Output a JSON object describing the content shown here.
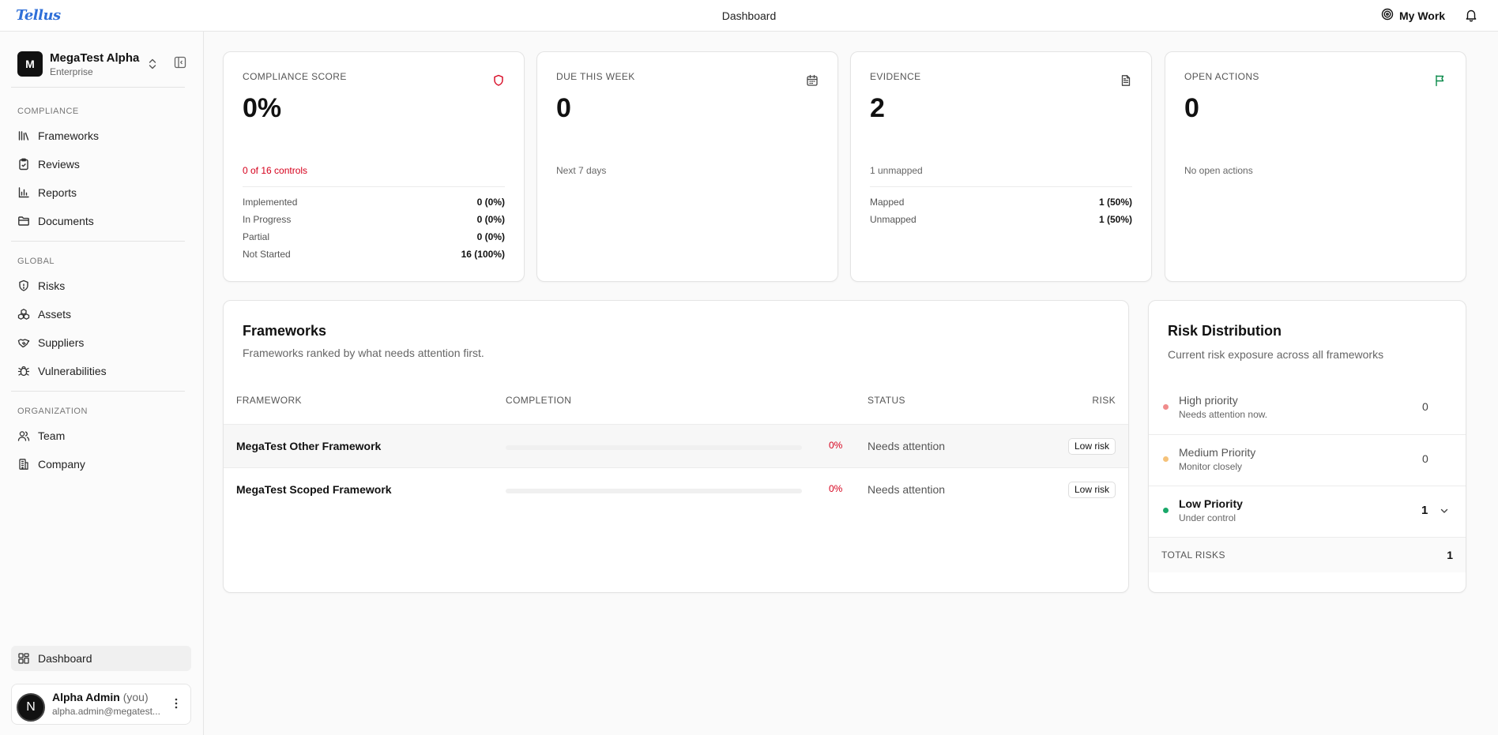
{
  "topbar": {
    "logo": "Tellus",
    "title": "Dashboard",
    "my_work": "My Work"
  },
  "sidebar": {
    "org": {
      "initial": "M",
      "name": "MegaTest Alpha",
      "plan": "Enterprise"
    },
    "sections": [
      {
        "label": "COMPLIANCE",
        "items": [
          {
            "label": "Frameworks",
            "icon": "library-icon"
          },
          {
            "label": "Reviews",
            "icon": "clipboard-check-icon"
          },
          {
            "label": "Reports",
            "icon": "bar-chart-icon"
          },
          {
            "label": "Documents",
            "icon": "folder-icon"
          }
        ]
      },
      {
        "label": "GLOBAL",
        "items": [
          {
            "label": "Risks",
            "icon": "shield-icon"
          },
          {
            "label": "Assets",
            "icon": "boxes-icon"
          },
          {
            "label": "Suppliers",
            "icon": "handshake-icon"
          },
          {
            "label": "Vulnerabilities",
            "icon": "bug-icon"
          }
        ]
      },
      {
        "label": "ORGANIZATION",
        "items": [
          {
            "label": "Team",
            "icon": "users-icon"
          },
          {
            "label": "Company",
            "icon": "building-icon"
          }
        ]
      }
    ],
    "dashboard_label": "Dashboard",
    "user": {
      "initial": "N",
      "name": "Alpha Admin",
      "you": "(you)",
      "email": "alpha.admin@megatest..."
    }
  },
  "stats": {
    "compliance": {
      "label": "COMPLIANCE SCORE",
      "value": "0%",
      "sub": "0 of 16 controls",
      "rows": [
        {
          "k": "Implemented",
          "v": "0 (0%)"
        },
        {
          "k": "In Progress",
          "v": "0 (0%)"
        },
        {
          "k": "Partial",
          "v": "0 (0%)"
        },
        {
          "k": "Not Started",
          "v": "16 (100%)"
        }
      ],
      "icon_color": "#d6001c"
    },
    "due": {
      "label": "DUE THIS WEEK",
      "value": "0",
      "sub": "Next 7 days"
    },
    "evidence": {
      "label": "EVIDENCE",
      "value": "2",
      "sub": "1 unmapped",
      "rows": [
        {
          "k": "Mapped",
          "v": "1 (50%)"
        },
        {
          "k": "Unmapped",
          "v": "1 (50%)"
        }
      ]
    },
    "actions": {
      "label": "OPEN ACTIONS",
      "value": "0",
      "sub": "No open actions",
      "icon_color": "#0a8a4a"
    }
  },
  "frameworks": {
    "title": "Frameworks",
    "description": "Frameworks ranked by what needs attention first.",
    "columns": {
      "framework": "FRAMEWORK",
      "completion": "COMPLETION",
      "status": "STATUS",
      "risk": "RISK"
    },
    "rows": [
      {
        "name": "MegaTest Other Framework",
        "completion": 0,
        "completion_label": "0%",
        "status": "Needs attention",
        "risk": "Low risk"
      },
      {
        "name": "MegaTest Scoped Framework",
        "completion": 0,
        "completion_label": "0%",
        "status": "Needs attention",
        "risk": "Low risk"
      }
    ]
  },
  "risk_distribution": {
    "title": "Risk Distribution",
    "description": "Current risk exposure across all frameworks",
    "rows": [
      {
        "name": "High priority",
        "sub": "Needs attention now.",
        "count": "0",
        "color": "#f08c8c"
      },
      {
        "name": "Medium Priority",
        "sub": "Monitor closely",
        "count": "0",
        "color": "#f5c27a"
      },
      {
        "name": "Low Priority",
        "sub": "Under control",
        "count": "1",
        "color": "#1aa86a"
      }
    ],
    "total_label": "TOTAL RISKS",
    "total_value": "1"
  }
}
